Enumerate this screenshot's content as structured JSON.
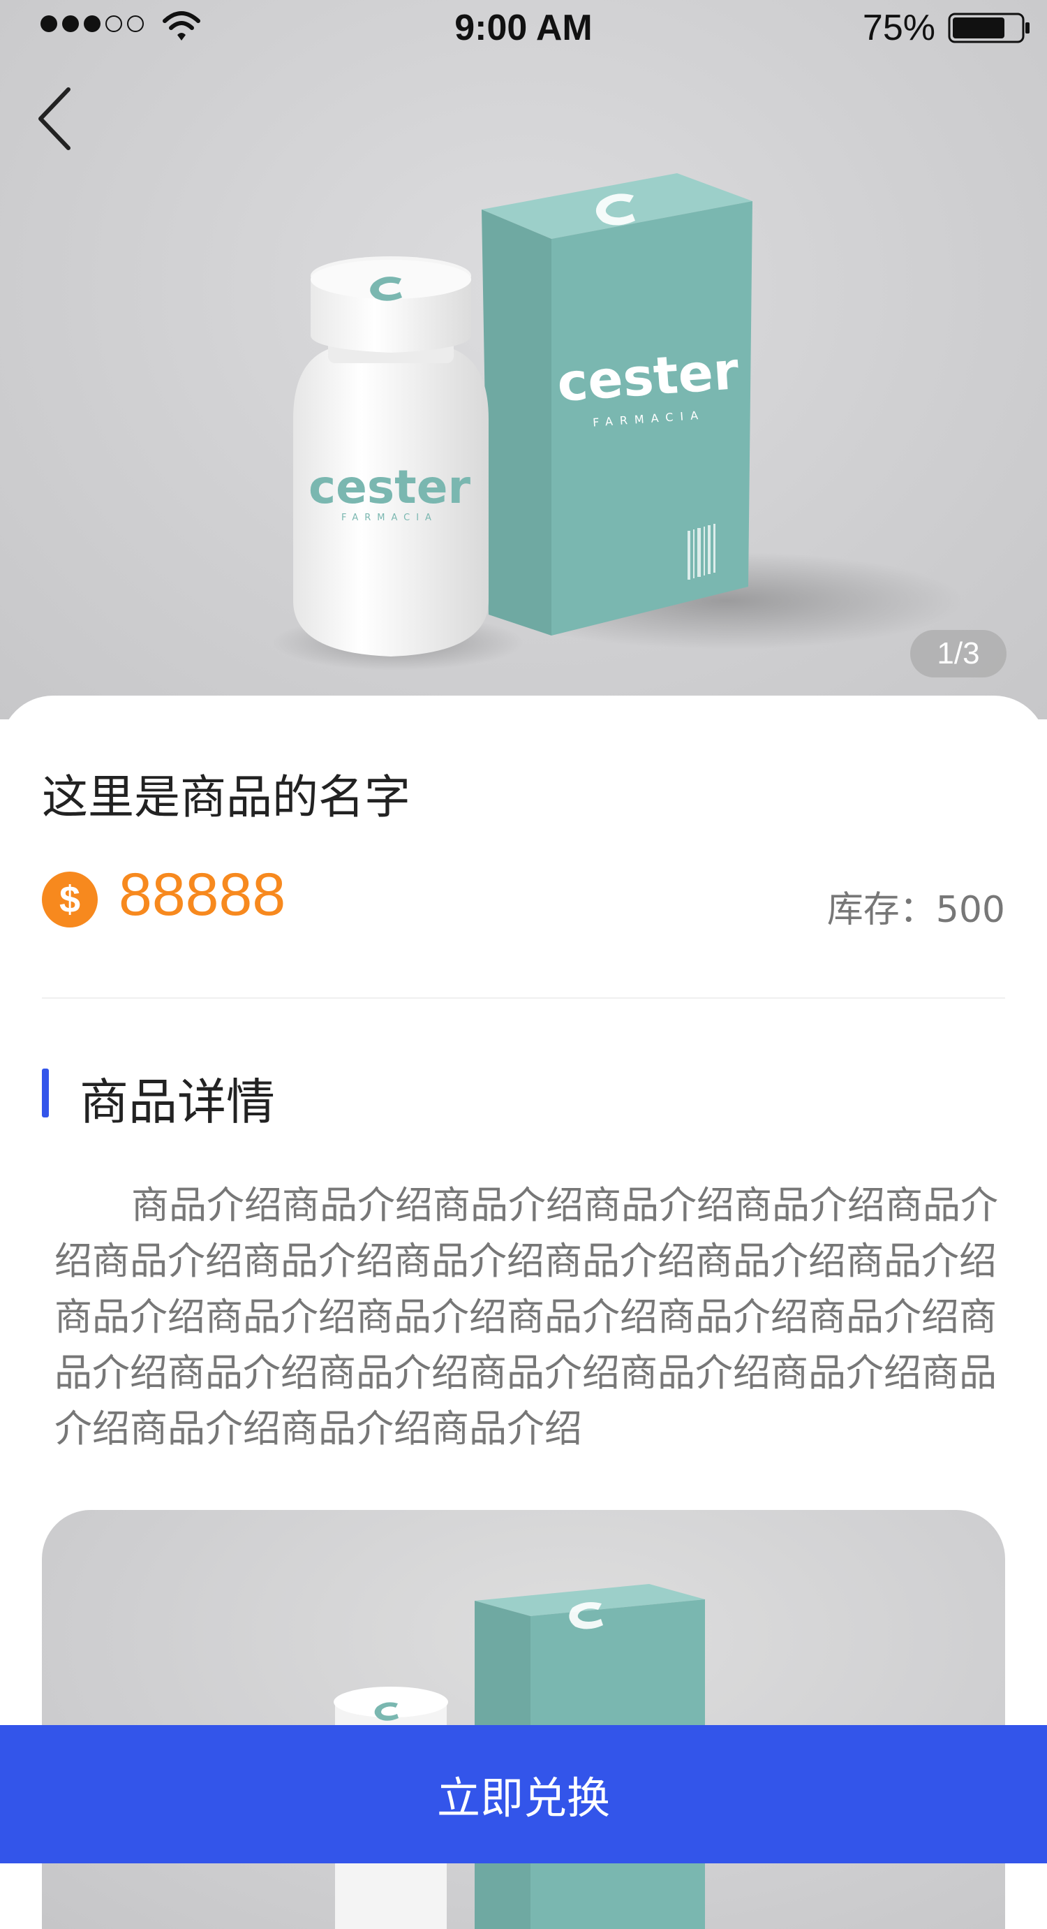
{
  "status_bar": {
    "time": "9:00 AM",
    "battery": "75%",
    "signal_strength": 3,
    "signal_max": 5
  },
  "icons": {
    "back": "chevron-left-icon",
    "coin": "dollar-coin-icon",
    "wifi": "wifi-icon",
    "battery": "battery-icon"
  },
  "gallery": {
    "indicator": "1/3",
    "brand_text": "cester",
    "brand_sub": "FARMACIA"
  },
  "product": {
    "name": "这里是商品的名字",
    "coin_symbol": "$",
    "price": "88888",
    "stock": "库存：500"
  },
  "detail": {
    "section_title": "商品详情",
    "description": "商品介绍商品介绍商品介绍商品介绍商品介绍商品介绍商品介绍商品介绍商品介绍商品介绍商品介绍商品介绍商品介绍商品介绍商品介绍商品介绍商品介绍商品介绍商品介绍商品介绍商品介绍商品介绍商品介绍商品介绍商品介绍商品介绍商品介绍商品介绍"
  },
  "actions": {
    "exchange_label": "立即兑换"
  },
  "colors": {
    "accent": "#3355ea",
    "price": "#f7891e",
    "product_teal": "#7ab7b0"
  }
}
